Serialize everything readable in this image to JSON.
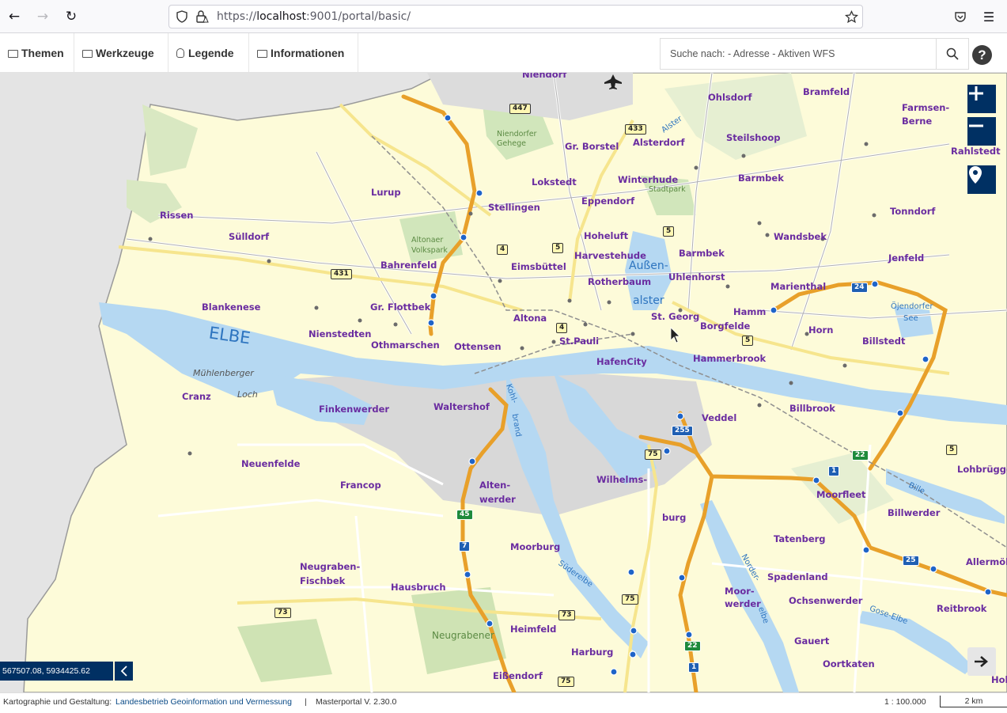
{
  "browser": {
    "url_prefix": "https://",
    "url_host": "localhost",
    "url_rest": ":9001/portal/basic/"
  },
  "menu": {
    "items": [
      {
        "label": "Themen"
      },
      {
        "label": "Werkzeuge"
      },
      {
        "label": "Legende"
      },
      {
        "label": "Informationen"
      }
    ],
    "search_placeholder": "Suche nach: - Adresse - Aktiven WFS",
    "help_label": "?"
  },
  "map": {
    "zoom_in": "+",
    "zoom_out": "−",
    "coordinates": "567507.08, 5934425.62",
    "places": [
      "Niendorf",
      "Ohlsdorf",
      "Bramfeld",
      "Farmsen-",
      "Berne",
      "Rahlstedt",
      "Gr. Borstel",
      "Alsterdorf",
      "Steilshoop",
      "Lokstedt",
      "Winterhude",
      "Barmbek",
      "Lurup",
      "Tonndorf",
      "Eppendorf",
      "Stellingen",
      "Rissen",
      "Sülldorf",
      "Hoheluft",
      "Wandsbek",
      "Harvestehude",
      "Barmbek",
      "Jenfeld",
      "Eimsbüttel",
      "Bahrenfeld",
      "Uhlenhorst",
      "Marienthal",
      "Rotherbaum",
      "Blankenese",
      "Gr. Flottbek",
      "Hamm",
      "St. Georg",
      "Altona",
      "Borgfelde",
      "Horn",
      "Billstedt",
      "Nienstedten",
      "Othmarschen",
      "Ottensen",
      "St.Pauli",
      "HafenCity",
      "Hammerbrook",
      "Cranz",
      "Finkenwerder",
      "Waltershof",
      "Veddel",
      "Billbrook",
      "Neuenfelde",
      "Francop",
      "Alten-",
      "werder",
      "Wilhelms-",
      "burg",
      "Moorfleet",
      "Lohbrügge",
      "Billwerder",
      "Tatenberg",
      "Moorburg",
      "Neugraben-",
      "Fischbek",
      "Allermöh",
      "Spadenland",
      "Hausbruch",
      "Moor-",
      "werder",
      "Ochsenwerder",
      "Reitbrook",
      "Heimfeld",
      "Gauert",
      "Harburg",
      "Oortkaten",
      "Eißendorf",
      "Hol"
    ],
    "parks": [
      "Niendorfer",
      "Gehege",
      "Stadtpark",
      "Altonaer",
      "Volkspark",
      "Neugrabener"
    ],
    "waters": [
      "ELBE",
      "Mühlenberger",
      "Loch",
      "Außen-",
      "alster",
      "Alster",
      "Öjendorfer",
      "See",
      "Kohl-",
      "brand",
      "Süderelbe",
      "Norder-",
      "elbe",
      "Bille",
      "Gose-Elbe"
    ],
    "roads": [
      "447",
      "433",
      "5",
      "4",
      "5",
      "431",
      "24",
      "4",
      "5",
      "255",
      "75",
      "22",
      "1",
      "5",
      "45",
      "7",
      "25",
      "75",
      "73",
      "73",
      "22",
      "1",
      "75"
    ]
  },
  "footer": {
    "credit_label": "Kartographie und Gestaltung:",
    "credit_link": "Landesbetrieb Geoinformation und Vermessung",
    "separator": "|",
    "version": "Masterportal V. 2.30.0",
    "scale": "1 : 100.000",
    "scalebar": "2 km"
  },
  "colors": {
    "accent": "#003063",
    "place_label": "#6a2ca0",
    "motorway": "#e8a02a",
    "water": "#b5d8f2",
    "land": "#fdfbd9"
  }
}
